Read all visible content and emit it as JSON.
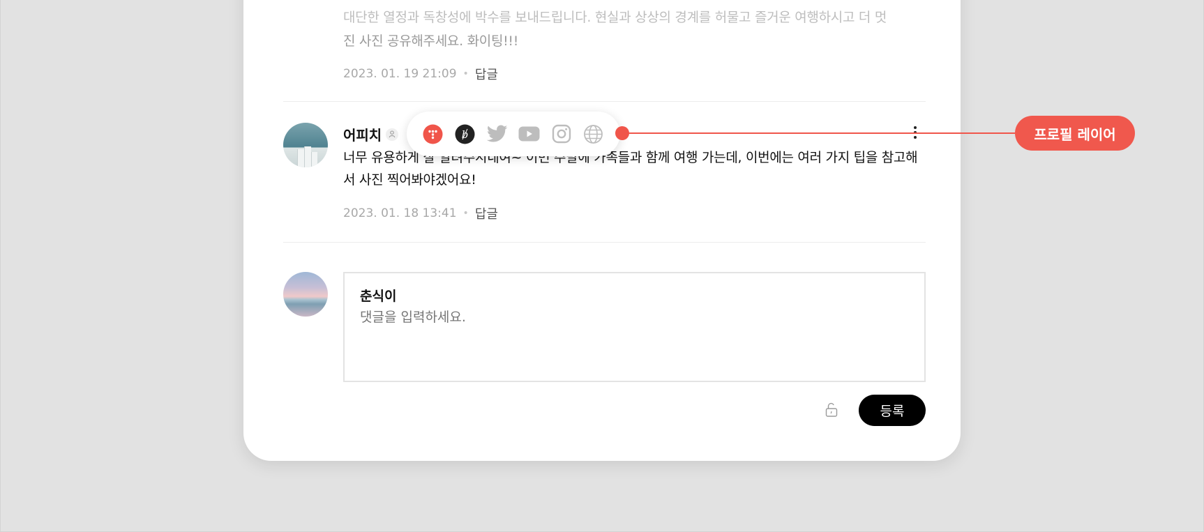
{
  "previous_comment": {
    "text_line1": "대단한 열정과 독창성에 박수를 보내드립니다. 현실과 상상의 경계를 허물고 즐거운 여행하시고 더 멋",
    "text_line2": "진 사진 공유해주세요. 화이팅!!!",
    "timestamp": "2023. 01. 19 21:09",
    "reply_label": "답글"
  },
  "comment": {
    "author": "어피치",
    "text": "너무 유용하게 잘 알려주시네여~ 이번 주말에 가족들과 함께 여행 가는데, 이번에는 여러 가지 팁을 참고해서 사진 찍어봐야겠어요!",
    "timestamp": "2023. 01. 18 13:41",
    "reply_label": "답글"
  },
  "profile_layer": {
    "icons": [
      "brand-icon",
      "brunch-icon",
      "twitter-icon",
      "youtube-icon",
      "instagram-icon",
      "globe-icon"
    ],
    "callout_label": "프로필 레이어",
    "accent_color": "#f0554a"
  },
  "compose": {
    "user_name": "춘식이",
    "placeholder": "댓글을 입력하세요.",
    "submit_label": "등록"
  }
}
